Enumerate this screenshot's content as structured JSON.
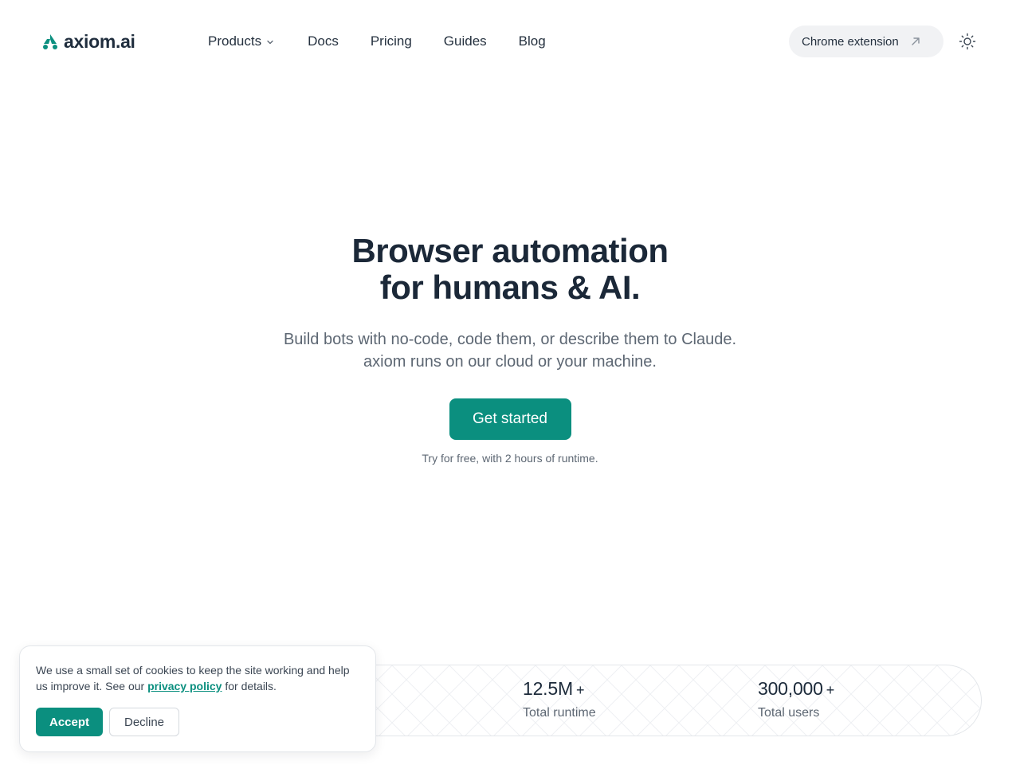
{
  "brand": {
    "name": "axiom.ai",
    "accent": "#0b8f7f",
    "logo_icon": "axiom-logo-icon"
  },
  "nav": {
    "items": [
      {
        "label": "Products",
        "has_dropdown": true
      },
      {
        "label": "Docs"
      },
      {
        "label": "Pricing"
      },
      {
        "label": "Guides"
      },
      {
        "label": "Blog"
      }
    ],
    "chrome_extension_label": "Chrome extension",
    "chrome_extension_icon": "external-arrow-icon",
    "theme_toggle_icon": "sun-icon"
  },
  "hero": {
    "title_line1": "Browser automation",
    "title_line2": "for humans & AI.",
    "subtitle_line1": "Build bots with no-code, code them, or describe them to Claude.",
    "subtitle_line2": "axiom runs on our cloud or your machine.",
    "cta_label": "Get started",
    "cta_note": "Try for free, with 2 hours of runtime."
  },
  "stats": [
    {
      "value": "12.5M",
      "suffix": "+",
      "label": "Total runtime"
    },
    {
      "value": "300,000",
      "suffix": "+",
      "label": "Total users"
    }
  ],
  "cookie_banner": {
    "text_before": "We use a small set of cookies to keep the site working and help us improve it. See our ",
    "link_text": "privacy policy",
    "text_after": " for details.",
    "accept_label": "Accept",
    "decline_label": "Decline"
  }
}
